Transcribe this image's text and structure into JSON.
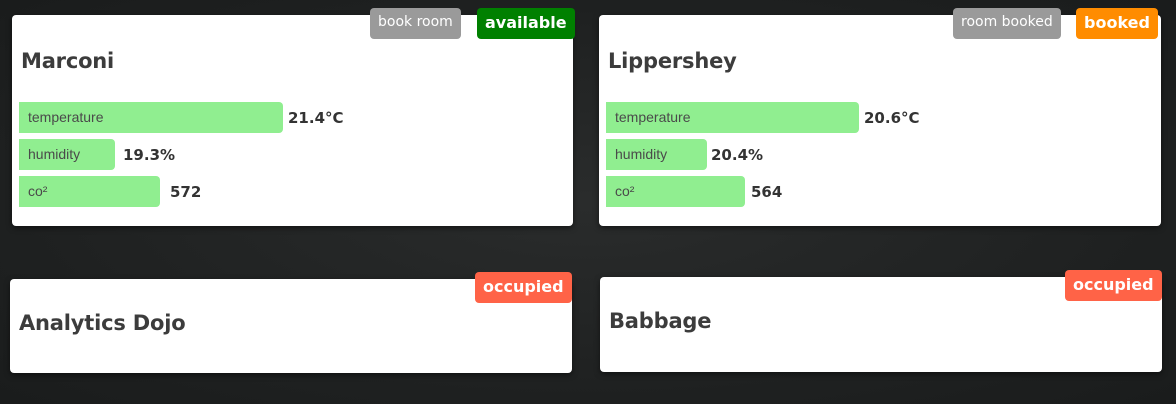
{
  "colors": {
    "bar_fill": "#90ee90",
    "available": "#008000",
    "booked": "#ff8c00",
    "occupied": "#ff6347",
    "action_button": "#9a9a9a"
  },
  "rooms": [
    {
      "name": "Marconi",
      "action_label": "book room",
      "status_label": "available",
      "status_color": "#008000",
      "metrics": [
        {
          "label": "temperature",
          "value": "21.4°C",
          "fill_percent": 47
        },
        {
          "label": "humidity",
          "value": "19.3%",
          "fill_percent": 16
        },
        {
          "label": "co²",
          "value": "572",
          "fill_percent": 25
        }
      ]
    },
    {
      "name": "Lippershey",
      "action_label": "room booked",
      "status_label": "booked",
      "status_color": "#ff8c00",
      "metrics": [
        {
          "label": "temperature",
          "value": "20.6°C",
          "fill_percent": 45
        },
        {
          "label": "humidity",
          "value": "20.4%",
          "fill_percent": 18
        },
        {
          "label": "co²",
          "value": "564",
          "fill_percent": 25
        }
      ]
    },
    {
      "name": "Analytics Dojo",
      "status_label": "occupied",
      "status_color": "#ff6347"
    },
    {
      "name": "Babbage",
      "status_label": "occupied",
      "status_color": "#ff6347"
    }
  ]
}
